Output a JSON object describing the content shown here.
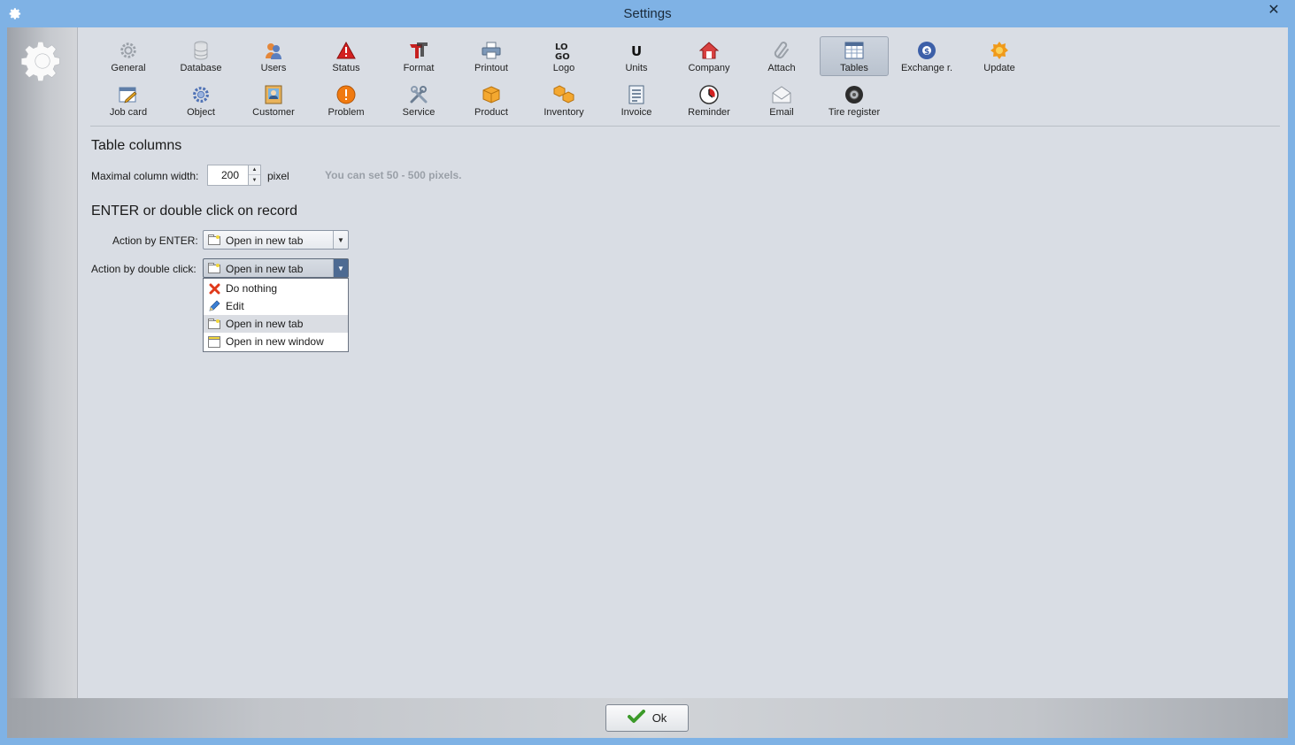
{
  "window": {
    "title": "Settings",
    "close_glyph": "✕",
    "app_icon": "gear-icon"
  },
  "sidebar": {
    "icon": "gear-icon"
  },
  "toolbar": {
    "row1": [
      {
        "label": "General",
        "icon": "gear-icon"
      },
      {
        "label": "Database",
        "icon": "database-icon"
      },
      {
        "label": "Users",
        "icon": "users-icon"
      },
      {
        "label": "Status",
        "icon": "warning-icon"
      },
      {
        "label": "Format",
        "icon": "format-icon"
      },
      {
        "label": "Printout",
        "icon": "printer-icon"
      },
      {
        "label": "Logo",
        "icon": "logo-icon"
      },
      {
        "label": "Units",
        "icon": "units-icon"
      },
      {
        "label": "Company",
        "icon": "house-icon"
      },
      {
        "label": "Attach",
        "icon": "paperclip-icon"
      },
      {
        "label": "Tables",
        "icon": "table-icon",
        "active": true
      },
      {
        "label": "Exchange r.",
        "icon": "exchange-icon"
      },
      {
        "label": "Update",
        "icon": "update-icon"
      }
    ],
    "row2": [
      {
        "label": "Job card",
        "icon": "job-card-icon"
      },
      {
        "label": "Object",
        "icon": "object-gear-icon"
      },
      {
        "label": "Customer",
        "icon": "customer-icon"
      },
      {
        "label": "Problem",
        "icon": "problem-icon"
      },
      {
        "label": "Service",
        "icon": "tools-icon"
      },
      {
        "label": "Product",
        "icon": "box-icon"
      },
      {
        "label": "Inventory",
        "icon": "boxes-icon"
      },
      {
        "label": "Invoice",
        "icon": "invoice-icon"
      },
      {
        "label": "Reminder",
        "icon": "clock-icon"
      },
      {
        "label": "Email",
        "icon": "envelope-icon"
      },
      {
        "label": "Tire register",
        "icon": "tire-icon"
      }
    ]
  },
  "table_columns": {
    "heading": "Table columns",
    "max_width_label": "Maximal column width:",
    "max_width_value": "200",
    "unit": "pixel",
    "hint": "You can set 50 - 500 pixels."
  },
  "record_action": {
    "heading": "ENTER or double click on record",
    "enter_label": "Action by ENTER:",
    "enter_value": "Open in new tab",
    "dblclick_label": "Action by double click:",
    "dblclick_value": "Open in new tab",
    "options": [
      {
        "label": "Do nothing",
        "icon": "red-x-icon"
      },
      {
        "label": "Edit",
        "icon": "pencil-icon"
      },
      {
        "label": "Open in new tab",
        "icon": "new-tab-icon",
        "selected": true
      },
      {
        "label": "Open in new window",
        "icon": "new-window-icon"
      }
    ]
  },
  "footer": {
    "ok_label": "Ok",
    "ok_icon": "checkmark-icon"
  },
  "colors": {
    "title_bar": "#7fb2e5",
    "panel": "#d9dde4",
    "active_tool": "#c3cad5",
    "combo_arrow_open": "#4d6a92"
  }
}
